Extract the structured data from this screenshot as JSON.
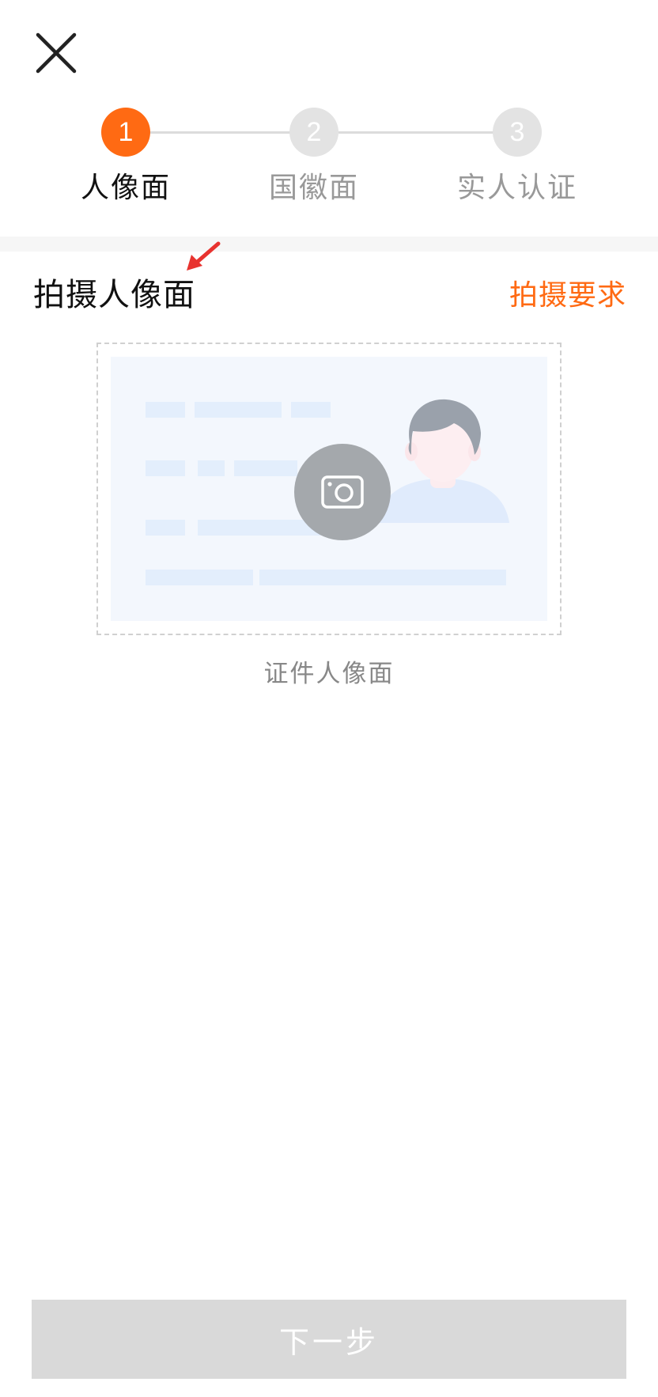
{
  "header": {
    "close_icon": "close-icon"
  },
  "stepper": {
    "steps": [
      {
        "number": "1",
        "label": "人像面",
        "state": "active"
      },
      {
        "number": "2",
        "label": "国徽面",
        "state": "pending"
      },
      {
        "number": "3",
        "label": "实人认证",
        "state": "pending"
      }
    ]
  },
  "section": {
    "title": "拍摄人像面",
    "requirements_link": "拍摄要求"
  },
  "capture": {
    "camera_icon": "camera-icon",
    "caption": "证件人像面"
  },
  "footer": {
    "next_label": "下一步"
  },
  "colors": {
    "accent": "#ff6a13",
    "disabled_button": "#d9d9d9",
    "annotation_arrow": "#e8332f"
  }
}
